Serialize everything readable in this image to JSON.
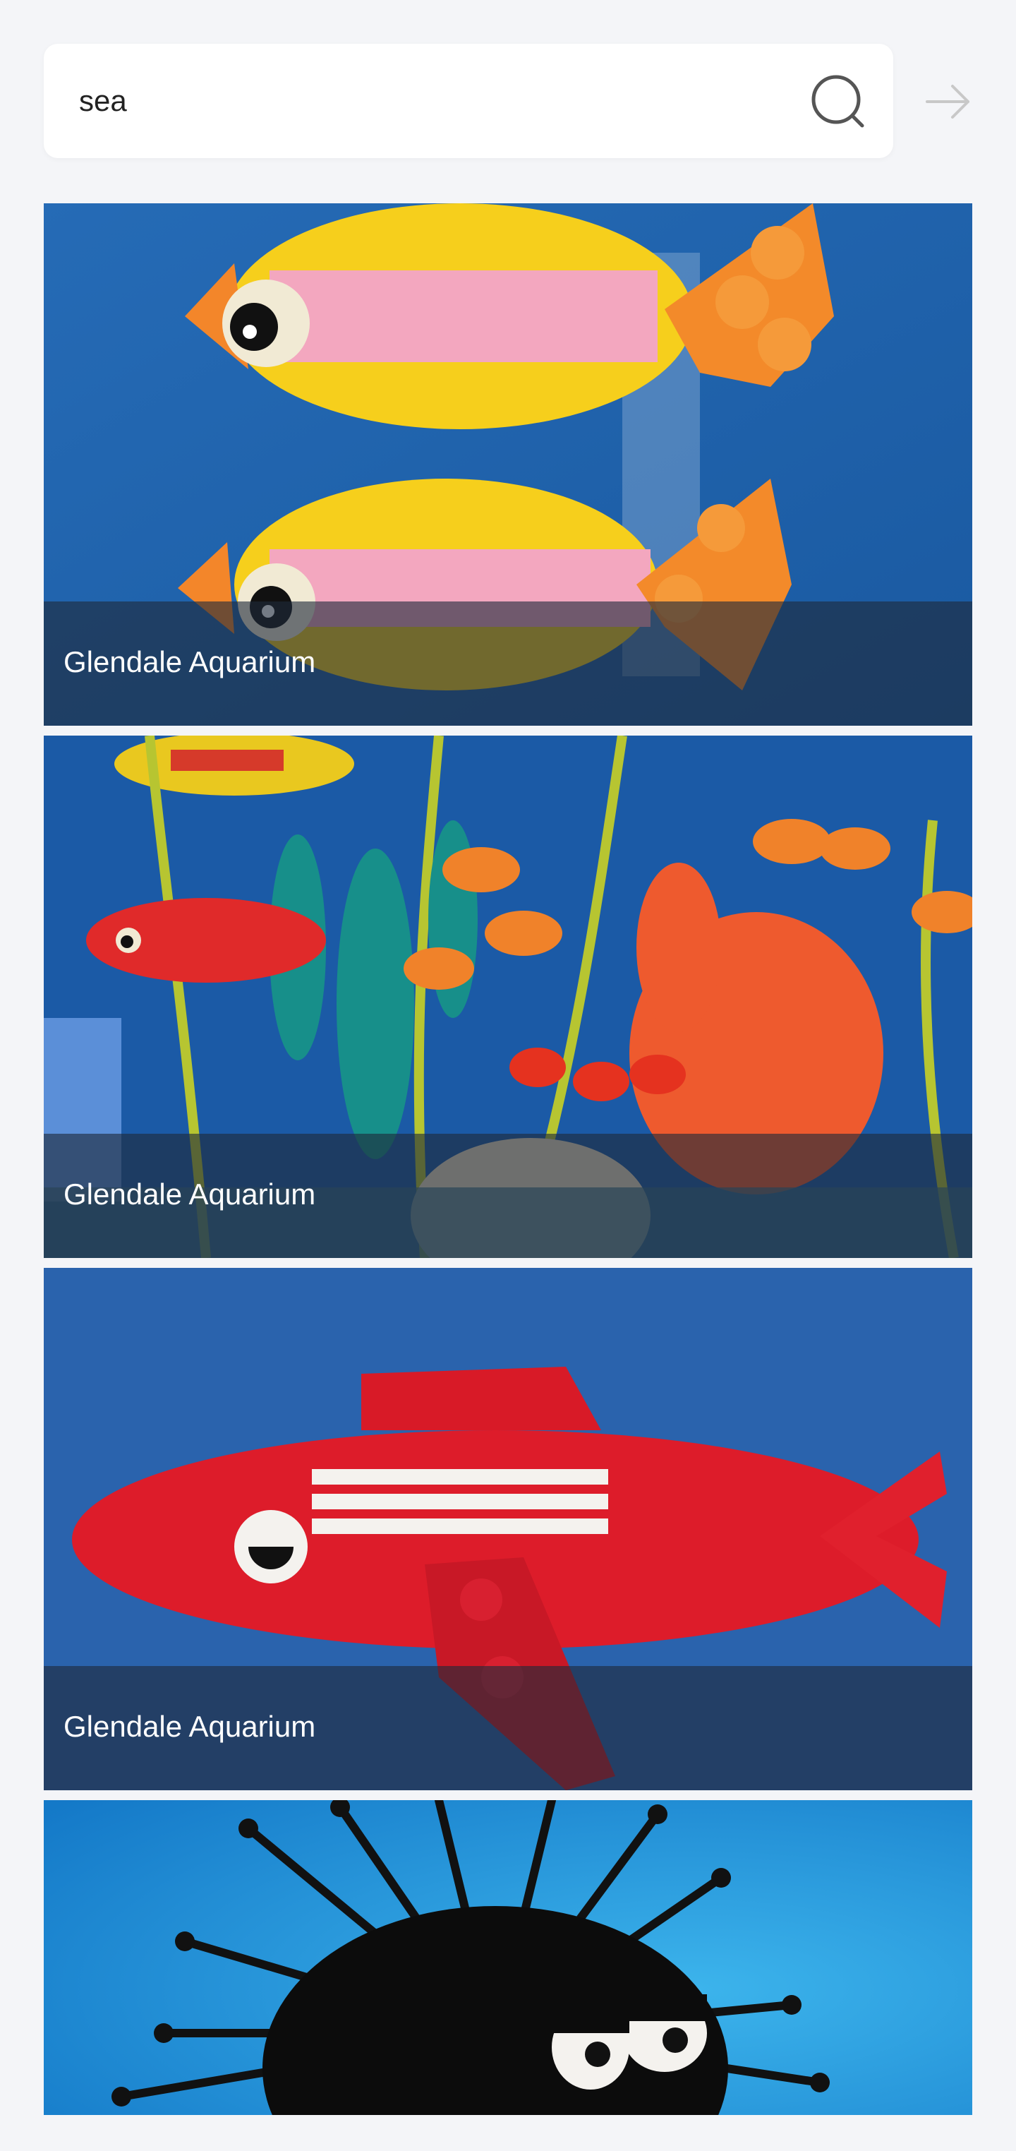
{
  "search": {
    "value": "sea",
    "icon": "search-icon",
    "go_icon": "arrow-right-icon"
  },
  "results": [
    {
      "caption": "Glendale Aquarium",
      "image": "lego-yellow-pink-fish-pair"
    },
    {
      "caption": "Glendale Aquarium",
      "image": "lego-coral-reef-scene"
    },
    {
      "caption": "Glendale Aquarium",
      "image": "lego-red-fish"
    },
    {
      "caption": "",
      "image": "lego-black-sea-urchin"
    }
  ],
  "colors": {
    "background": "#f4f5f8",
    "ocean_blue": "#1c5fa6",
    "caption_overlay": "#1e2a3a"
  }
}
